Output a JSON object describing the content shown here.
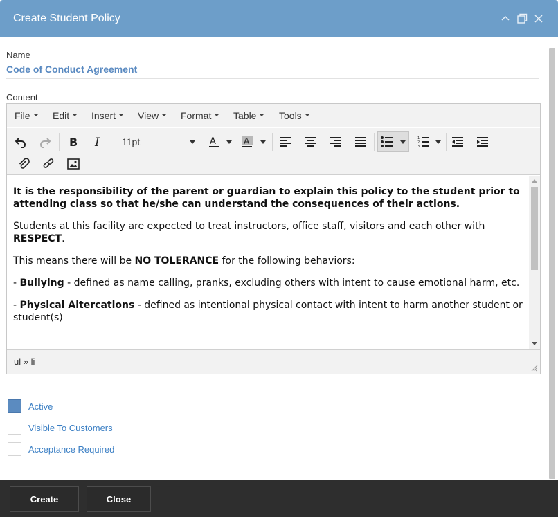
{
  "dialog": {
    "title": "Create Student Policy"
  },
  "form": {
    "name_label": "Name",
    "name_value": "Code of Conduct Agreement",
    "content_label": "Content"
  },
  "editor": {
    "menus": [
      "File",
      "Edit",
      "Insert",
      "View",
      "Format",
      "Table",
      "Tools"
    ],
    "font_size": "11pt",
    "paragraphs": [
      {
        "bold": "It is the responsibility of the parent or guardian to explain this policy to the student prior to attending class so that he/she can understand the consequences of their actions."
      },
      {
        "text": "Students at this facility are expected to treat instructors, office staff, visitors and each other with ",
        "bold": "RESPECT",
        "tail": "."
      },
      {
        "text": "This means there will be ",
        "bold": "NO TOLERANCE",
        "tail": " for the following behaviors:"
      },
      {
        "text": " - ",
        "bold": "Bullying",
        "tail": " - defined as name calling, pranks, excluding others with intent to cause emotional harm, etc."
      },
      {
        "text": " - ",
        "bold": "Physical Altercations",
        "tail": " - defined as intentional physical contact with intent to harm another student or student(s)"
      }
    ],
    "status_path": "ul » li"
  },
  "options": [
    {
      "label": "Active",
      "checked": true
    },
    {
      "label": "Visible To Customers",
      "checked": false
    },
    {
      "label": "Acceptance Required",
      "checked": false
    }
  ],
  "footer": {
    "create_label": "Create",
    "close_label": "Close"
  },
  "colors": {
    "titlebar": "#6d9ec9",
    "accent": "#5b8bc0",
    "footer": "#2e2e2e",
    "link": "#3b7fc4"
  },
  "icons": [
    "minimize-icon",
    "restore-icon",
    "close-icon",
    "undo-icon",
    "redo-icon",
    "bold-icon",
    "italic-icon",
    "text-color-icon",
    "highlight-icon",
    "align-left-icon",
    "align-center-icon",
    "align-right-icon",
    "justify-icon",
    "bullet-list-icon",
    "numbered-list-icon",
    "outdent-icon",
    "indent-icon",
    "attachment-icon",
    "link-icon",
    "image-icon"
  ]
}
